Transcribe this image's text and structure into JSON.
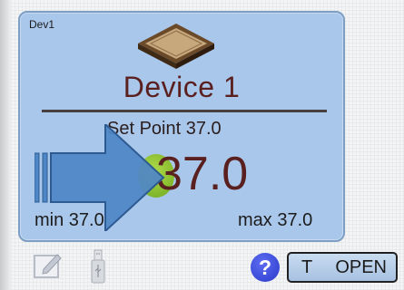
{
  "device": {
    "id": "Dev1",
    "name": "Device 1",
    "set_point": "Set Point 37.0",
    "current_value": "37.0",
    "min": "min 37.0",
    "max": "max 37.0"
  },
  "toolbar": {
    "help_label": "?",
    "button_prefix": "T",
    "button_label": "OPEN"
  },
  "icons": {
    "device": "device-icon",
    "edit": "edit-icon",
    "usb": "usb-icon",
    "help": "help-icon",
    "overlay_arrow": "arrow-right-icon"
  },
  "colors": {
    "panel": "#a9c7ea",
    "title_text": "#5a2020",
    "arrow": "#4f86c6",
    "knob": "#8cc63f",
    "help": "#3c4fdd"
  }
}
